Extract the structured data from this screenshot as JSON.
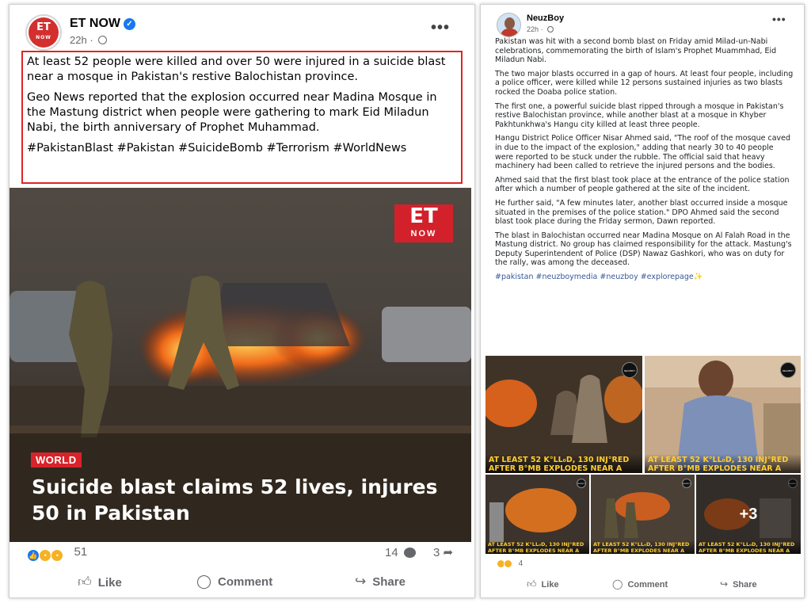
{
  "left_post": {
    "author": "ET NOW",
    "time": "22h",
    "paragraph1": "At least 52 people were killed and over 50 were injured in a suicide blast near a mosque in Pakistan's restive Balochistan province.",
    "paragraph2": "Geo News reported that the explosion occurred near Madina Mosque in the Mastung district when people were gathering to mark Eid Miladun Nabi, the birth anniversary of Prophet Muhammad.",
    "hashtags": "#PakistanBlast #Pakistan #SuicideBomb #Terrorism #WorldNews",
    "image": {
      "logo_top": "ET",
      "logo_bottom": "NOW",
      "tag": "WORLD",
      "headline": "Suicide blast claims 52 lives, injures 50 in Pakistan"
    },
    "reaction_count": "51",
    "comment_count": "14",
    "share_count": "3",
    "actions": {
      "like": "Like",
      "comment": "Comment",
      "share": "Share"
    }
  },
  "right_post": {
    "author": "NeuzBoy",
    "time": "22h",
    "paragraphs": [
      "Pakistan was hit with a second bomb blast on Friday amid Milad-un-Nabi celebrations, commemorating the birth of Islam's Prophet Muammhad, Eid Miladun Nabi.",
      "The two major blasts occurred in a gap of hours. At least four people, including a police officer, were killed while 12 persons sustained injuries as two blasts rocked the Doaba police station.",
      "The first one, a powerful suicide blast ripped through a mosque in Pakistan's restive Balochistan province, while another blast at a mosque in Khyber Pakhtunkhwa's Hangu city killed at least three people.",
      "Hangu District Police Officer Nisar Ahmed said, \"The roof of the mosque caved in due to the impact of the explosion,\" adding that nearly 30 to 40 people were reported to be stuck under the rubble. The official said that heavy machinery had been called to retrieve the injured persons and the bodies.",
      "Ahmed said that the first blast took place at the entrance of the police station after which a number of people gathered at the site of the incident.",
      "He further said, \"A few minutes later, another blast occurred inside a mosque situated in the premises of the police station.\" DPO Ahmed said the second blast took place during the Friday sermon, Dawn reported.",
      "The blast in Balochistan occurred near Madina Mosque on Al Falah Road in the Mastung district. No group has claimed responsibility for the attack. Mastung's Deputy Superintendent of Police (DSP) Nawaz Gashkori, who was on duty for the rally, was among the deceased."
    ],
    "hashtags": "#pakistan #neuzboymedia #neuzboy #explorepage✨",
    "thumb_caption_1": "AT LEAST 52 K°LL₀D, 130 INJ°RED",
    "thumb_caption_2": "AFTER B°MB EXPLODES NEAR A",
    "thumb_logo": "NEUZBOY",
    "more_photos": "+3",
    "reaction_count": "4",
    "actions": {
      "like": "Like",
      "comment": "Comment",
      "share": "Share"
    }
  },
  "icons": {
    "verified": "✓",
    "more": "•••",
    "like": "👍",
    "comment": "◯",
    "share": "↪"
  }
}
